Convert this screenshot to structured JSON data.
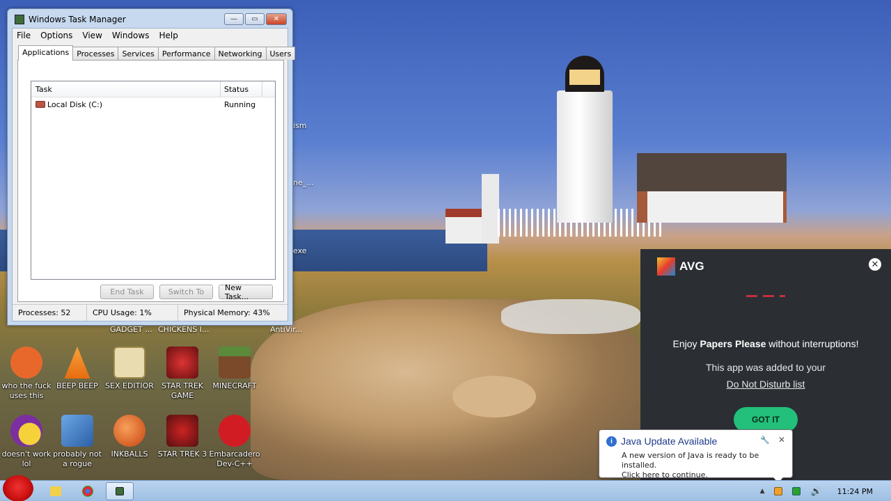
{
  "task_manager": {
    "title": "Windows Task Manager",
    "menu": [
      "File",
      "Options",
      "View",
      "Windows",
      "Help"
    ],
    "tabs": [
      "Applications",
      "Processes",
      "Services",
      "Performance",
      "Networking",
      "Users"
    ],
    "active_tab": "Applications",
    "columns": {
      "task": "Task",
      "status": "Status"
    },
    "rows": [
      {
        "task": "Local Disk (C:)",
        "status": "Running"
      }
    ],
    "buttons": {
      "end_task": "End Task",
      "switch_to": "Switch To",
      "new_task": "New Task..."
    },
    "status": {
      "processes": "Processes: 52",
      "cpu": "CPU Usage: 1%",
      "memory": "Physical Memory: 43%"
    }
  },
  "desktop": {
    "partial_labels": [
      "ism",
      "ne_...",
      "exe",
      "GADGET ...",
      "CHICKENS I...",
      "AntiVir..."
    ],
    "icons": [
      {
        "label": "who the fuck uses this",
        "icon": "flash-icon",
        "color": "#e8682c"
      },
      {
        "label": "BEEP BEEP",
        "icon": "vlc-cone-icon",
        "color": "#f08a16"
      },
      {
        "label": "SEX EDITIOR",
        "icon": "hxd-icon",
        "color": "#d9c27a"
      },
      {
        "label": "STAR TREK GAME",
        "icon": "star-trek-icon",
        "color": "#8c1c24"
      },
      {
        "label": "MINECRAFT",
        "icon": "minecraft-icon",
        "color": "#6b3a2a"
      },
      {
        "label": "doesn't work lol",
        "icon": "yahoo-messenger-icon",
        "color": "#7b2fa0"
      },
      {
        "label": "probably not a rogue",
        "icon": "gear-monitor-icon",
        "color": "#3f78c2"
      },
      {
        "label": "INKBALLS",
        "icon": "inkball-icon",
        "color": "#e5641e"
      },
      {
        "label": "STAR TREK 3",
        "icon": "star-trek-icon",
        "color": "#7a1f22"
      },
      {
        "label": "Embarcadero Dev-C++",
        "icon": "devcpp-icon",
        "color": "#d21c24"
      }
    ]
  },
  "avg": {
    "brand": "AVG",
    "line1_pre": "Enjoy ",
    "line1_bold": "Papers Please",
    "line1_post": " without interruptions!",
    "line2": "This app was added to your",
    "link": "Do Not Disturb list",
    "button": "GOT IT"
  },
  "java": {
    "title": "Java Update Available",
    "line1": "A new version of Java is ready to be installed.",
    "line2": "Click here to continue."
  },
  "taskbar": {
    "clock": "11:24 PM"
  }
}
